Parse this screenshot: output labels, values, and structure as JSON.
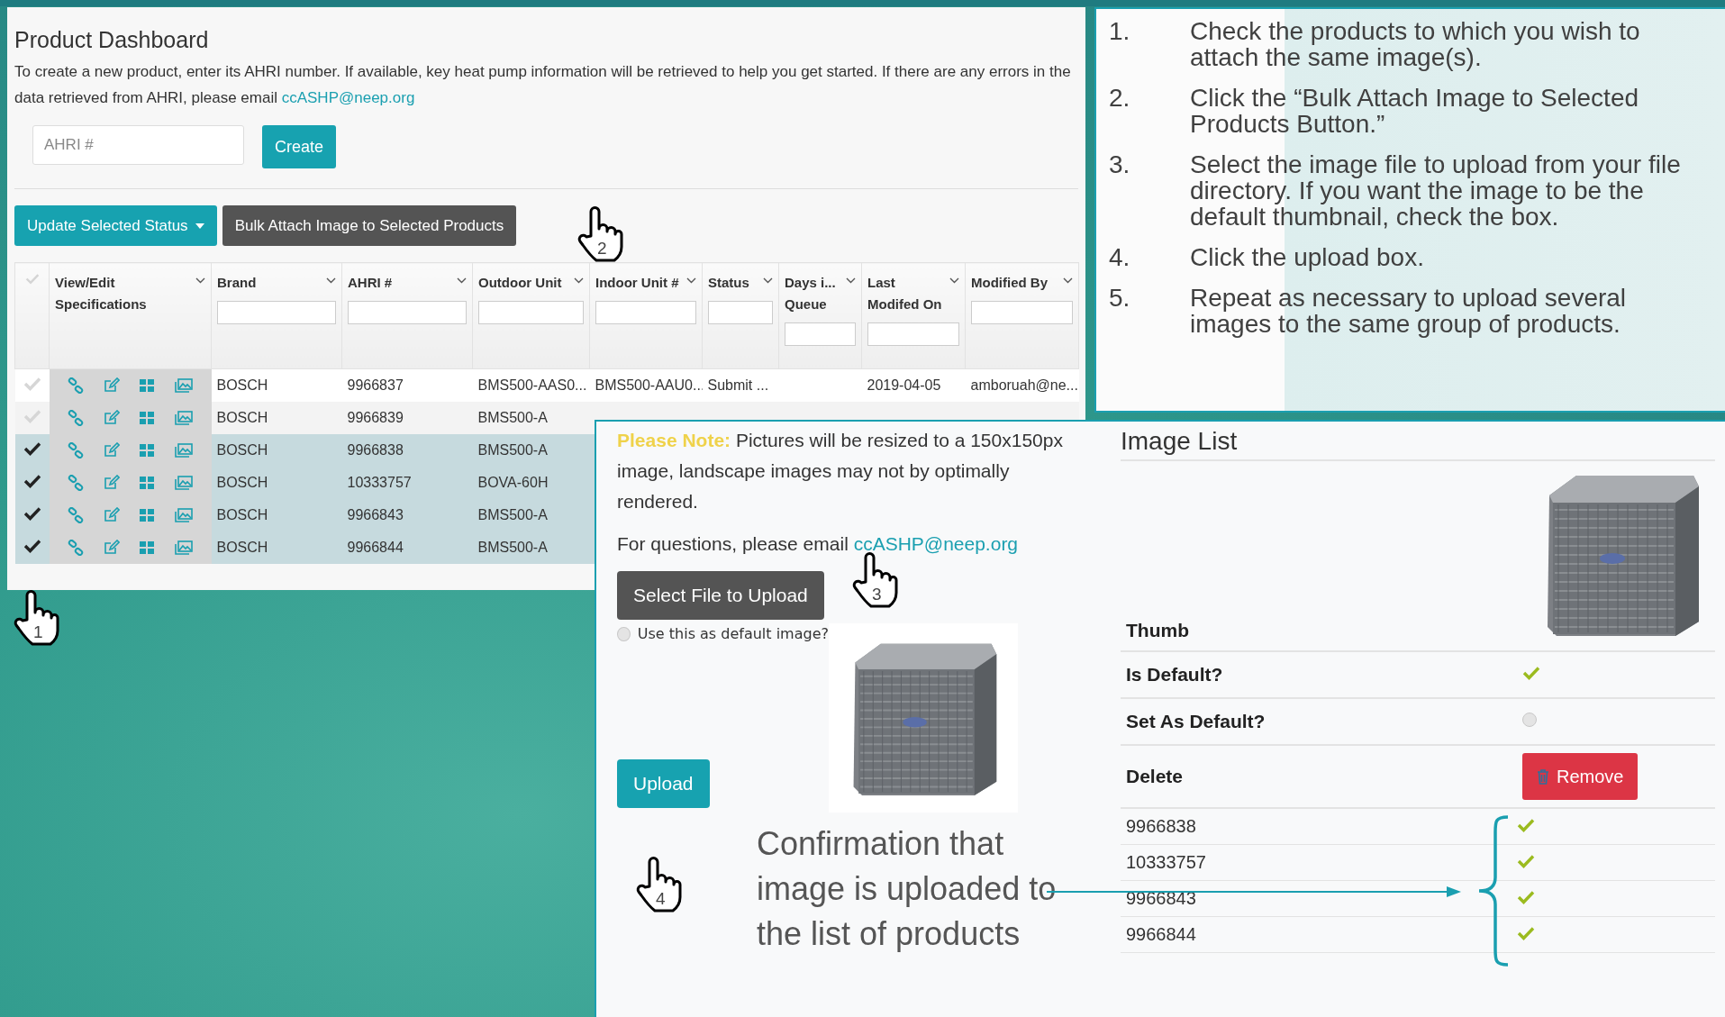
{
  "dashboard": {
    "title": "Product Dashboard",
    "description": "To create a new product, enter its AHRI number. If available, key heat pump information will be retrieved to help you get started. If there are any errors in the data retrieved from AHRI, please email",
    "email_link": "ccASHP@neep.org",
    "ahri_field": {
      "placeholder": "AHRI #"
    },
    "create_button": "Create",
    "status_button": "Update Selected Status",
    "bulk_button": "Bulk Attach Image to Selected Products",
    "table": {
      "actions_label": "View/Edit Specifications",
      "columns": [
        {
          "kind": "text",
          "label": "Brand"
        },
        {
          "kind": "text",
          "label": "AHRI #"
        },
        {
          "kind": "text",
          "label": "Outdoor Unit"
        },
        {
          "kind": "text",
          "label": "Indoor Unit #"
        },
        {
          "kind": "text",
          "label": "Status"
        },
        {
          "kind": "text",
          "label": "Days i... Queue"
        },
        {
          "kind": "text",
          "label": "Last Modifed On"
        },
        {
          "kind": "text",
          "label": "Modified By"
        }
      ],
      "rows": [
        {
          "selected": false,
          "cells": [
            "BOSCH",
            "9966837",
            "BMS500-AAS0...",
            "BMS500-AAU0...",
            "Submit ...",
            null,
            "2019-04-05",
            "amboruah@ne..."
          ]
        },
        {
          "selected": false,
          "cells": [
            "BOSCH",
            "9966839",
            "BMS500-A"
          ]
        },
        {
          "selected": true,
          "cells": [
            "BOSCH",
            "9966838",
            "BMS500-A"
          ]
        },
        {
          "selected": true,
          "cells": [
            "BOSCH",
            "10333757",
            "BOVA-60H"
          ]
        },
        {
          "selected": true,
          "cells": [
            "BOSCH",
            "9966843",
            "BMS500-A"
          ]
        },
        {
          "selected": true,
          "cells": [
            "BOSCH",
            "9966844",
            "BMS500-A"
          ]
        }
      ]
    }
  },
  "instructions": [
    {
      "number": "1.",
      "text": "Check the products to which you wish to attach the same image(s)."
    },
    {
      "number": "2.",
      "text": "Click the “Bulk Attach Image to Selected Products Button.”"
    },
    {
      "number": "3.",
      "text": "Select the image file to upload from your file directory. If you want the image to be the default thumbnail, check the box."
    },
    {
      "number": "4.",
      "text": "Click the upload box."
    },
    {
      "number": "5.",
      "text": "Repeat as necessary to upload several images to the same group of products."
    }
  ],
  "upload": {
    "note_label": "Please Note:",
    "note": "Pictures will be resized to a 150x150px image, landscape images may not by optimally rendered.",
    "questions": "For questions, please email",
    "email_link": "ccASHP@neep.org",
    "select_button": "Select File to Upload",
    "default_option": {
      "label": "Use this as default image?",
      "checked": false
    },
    "upload_button": "Upload",
    "confirmation": "Confirmation that image is uploaded to the list of products"
  },
  "image_list": {
    "title": "Image List",
    "fields": [
      {
        "kind": "image",
        "label": "Thumb"
      },
      {
        "kind": "check",
        "label": "Is Default?",
        "checked": true
      },
      {
        "kind": "radio",
        "label": "Set As Default?",
        "checked": false
      },
      {
        "kind": "button",
        "label": "Delete",
        "button": "Remove"
      }
    ],
    "products": [
      {
        "ahri": "9966838",
        "attached": true
      },
      {
        "ahri": "10333757",
        "attached": true
      },
      {
        "ahri": "9966843",
        "attached": true
      },
      {
        "ahri": "9966844",
        "attached": true
      }
    ]
  },
  "step_markers": [
    "1",
    "2",
    "3",
    "4"
  ]
}
